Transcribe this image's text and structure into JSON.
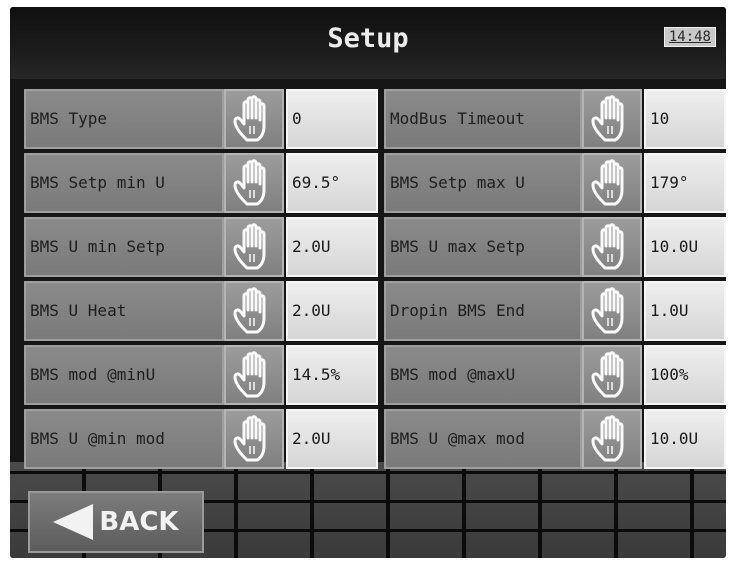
{
  "header": {
    "title": "Setup",
    "clock": "14:48"
  },
  "left_column": [
    {
      "label": "BMS Type",
      "value": "0"
    },
    {
      "label": "BMS Setp min U",
      "value": "69.5°"
    },
    {
      "label": "BMS U min Setp",
      "value": "2.0U"
    },
    {
      "label": "BMS U Heat",
      "value": "2.0U"
    },
    {
      "label": "BMS mod @minU",
      "value": "14.5%"
    },
    {
      "label": "BMS U @min mod",
      "value": "2.0U"
    }
  ],
  "right_column": [
    {
      "label": "ModBus Timeout",
      "value": "10"
    },
    {
      "label": "BMS Setp max U",
      "value": "179°"
    },
    {
      "label": "BMS U max Setp",
      "value": "10.0U"
    },
    {
      "label": "Dropin BMS End",
      "value": "1.0U"
    },
    {
      "label": "BMS mod @maxU",
      "value": "100%"
    },
    {
      "label": "BMS U @max mod",
      "value": "10.0U"
    }
  ],
  "footer": {
    "back_label": "BACK"
  },
  "icons": {
    "edit": "hand-icon",
    "back": "arrow-left-icon"
  },
  "colors": {
    "screen_bg": "#161616",
    "label_bg": "#808080",
    "value_bg": "#e4e4e4"
  }
}
